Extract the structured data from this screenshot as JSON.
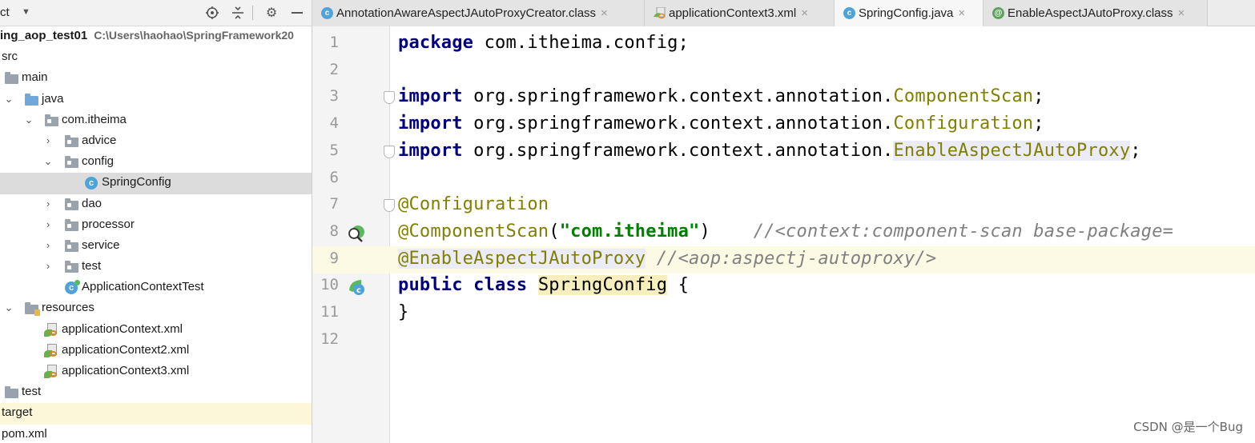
{
  "project_panel": {
    "title": "ct",
    "tree": [
      {
        "label": "ing_aop_test01",
        "path": "C:\\Users\\haohao\\SpringFramework20",
        "bold": true
      },
      {
        "label": "src"
      },
      {
        "label": "main"
      },
      {
        "label": "java"
      },
      {
        "label": "com.itheima"
      },
      {
        "label": "advice"
      },
      {
        "label": "config"
      },
      {
        "label": "SpringConfig"
      },
      {
        "label": "dao"
      },
      {
        "label": "processor"
      },
      {
        "label": "service"
      },
      {
        "label": "test"
      },
      {
        "label": "ApplicationContextTest"
      },
      {
        "label": "resources"
      },
      {
        "label": "applicationContext.xml"
      },
      {
        "label": "applicationContext2.xml"
      },
      {
        "label": "applicationContext3.xml"
      },
      {
        "label": "test"
      },
      {
        "label": "target"
      },
      {
        "label": "pom.xml"
      }
    ]
  },
  "tabs": [
    {
      "label": "AnnotationAwareAspectJAutoProxyCreator.class",
      "icon": "class-icon",
      "active": false
    },
    {
      "label": "applicationContext3.xml",
      "icon": "xml-icon",
      "active": false
    },
    {
      "label": "SpringConfig.java",
      "icon": "class-icon",
      "active": true
    },
    {
      "label": "EnableAspectJAutoProxy.class",
      "icon": "annotation-icon",
      "active": false
    }
  ],
  "tab_close": "×",
  "editor": {
    "lines": [
      {
        "num": "1",
        "tokens": [
          {
            "t": "package",
            "c": "kw"
          },
          {
            "t": " com.itheima.config;",
            "c": "punc"
          }
        ]
      },
      {
        "num": "2",
        "tokens": []
      },
      {
        "num": "3",
        "tokens": [
          {
            "t": "import",
            "c": "kw"
          },
          {
            "t": " org.springframework.context.annotation.",
            "c": "punc"
          },
          {
            "t": "ComponentScan",
            "c": "cls-ref"
          },
          {
            "t": ";",
            "c": "punc"
          }
        ]
      },
      {
        "num": "4",
        "tokens": [
          {
            "t": "import",
            "c": "kw"
          },
          {
            "t": " org.springframework.context.annotation.",
            "c": "punc"
          },
          {
            "t": "Configuration",
            "c": "cls-ref"
          },
          {
            "t": ";",
            "c": "punc"
          }
        ]
      },
      {
        "num": "5",
        "tokens": [
          {
            "t": "import",
            "c": "kw"
          },
          {
            "t": " org.springframework.context.annotation.",
            "c": "punc"
          },
          {
            "t": "EnableAspectJAutoProxy",
            "c": "cls-ref hl"
          },
          {
            "t": ";",
            "c": "punc"
          }
        ]
      },
      {
        "num": "6",
        "tokens": []
      },
      {
        "num": "7",
        "tokens": [
          {
            "t": "@Configuration",
            "c": "ann"
          }
        ]
      },
      {
        "num": "8",
        "tokens": [
          {
            "t": "@ComponentScan",
            "c": "ann"
          },
          {
            "t": "(",
            "c": "punc"
          },
          {
            "t": "\"com.itheima\"",
            "c": "str"
          },
          {
            "t": ")    ",
            "c": "punc"
          },
          {
            "t": "//<context:component-scan base-package=",
            "c": "cmt"
          }
        ]
      },
      {
        "num": "9",
        "tokens": [
          {
            "t": "@EnableAspectJAutoProxy",
            "c": "ann ann-hl"
          },
          {
            "t": " ",
            "c": "punc"
          },
          {
            "t": "//<aop:aspectj-autoproxy/>",
            "c": "cmt"
          }
        ]
      },
      {
        "num": "10",
        "tokens": [
          {
            "t": "public",
            "c": "kw"
          },
          {
            "t": " ",
            "c": "punc"
          },
          {
            "t": "class",
            "c": "kw"
          },
          {
            "t": " ",
            "c": "punc"
          },
          {
            "t": "SpringConfig",
            "c": "decl"
          },
          {
            "t": " {",
            "c": "punc"
          }
        ]
      },
      {
        "num": "11",
        "tokens": [
          {
            "t": "}",
            "c": "punc"
          }
        ]
      },
      {
        "num": "12",
        "tokens": []
      }
    ],
    "current_line": 9
  },
  "watermark": "CSDN @是一个Bug",
  "colors": {
    "keyword": "#000080",
    "annotation": "#808000",
    "string": "#008000",
    "comment": "#808080",
    "current_line": "#fcf9e4"
  }
}
